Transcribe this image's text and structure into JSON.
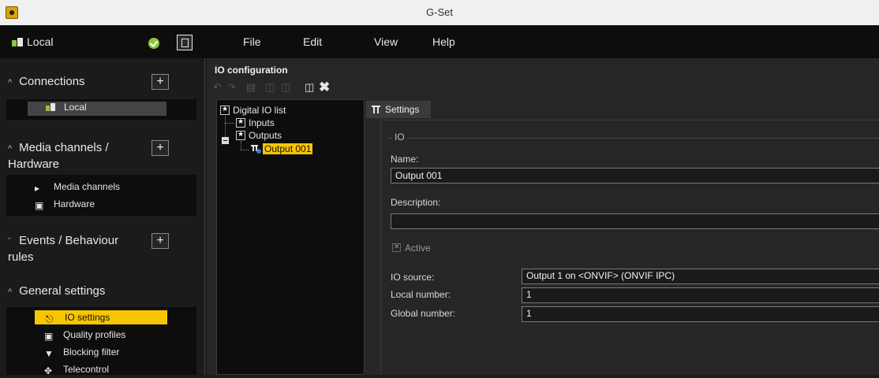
{
  "window": {
    "title": "G-Set"
  },
  "menubar": {
    "site": "Local",
    "menus": [
      "File",
      "Edit",
      "View",
      "Help"
    ]
  },
  "sidebar": {
    "connections": {
      "title": "Connections",
      "items": [
        "Local"
      ]
    },
    "media": {
      "title_line1": "Media channels /",
      "title_line2": "Hardware",
      "items": [
        "Media channels",
        "Hardware"
      ]
    },
    "events": {
      "title_line1": "Events / Behaviour",
      "title_line2": "rules"
    },
    "general": {
      "title": "General settings",
      "items": [
        "IO settings",
        "Quality profiles",
        "Blocking filter",
        "Telecontrol"
      ]
    }
  },
  "panel": {
    "title": "IO configuration",
    "tree": {
      "root": "Digital IO list",
      "inputs": "Inputs",
      "outputs": "Outputs",
      "selected": "Output 001"
    },
    "tab": "Settings",
    "group": "IO",
    "fields": {
      "name_label": "Name:",
      "name_value": "Output 001",
      "description_label": "Description:",
      "description_value": "",
      "active_label": "Active",
      "io_source_label": "IO source:",
      "io_source_value": "Output 1 on <ONVIF> (ONVIF IPC)",
      "local_number_label": "Local number:",
      "local_number_value": "1",
      "global_number_label": "Global number:",
      "global_number_value": "1"
    }
  }
}
